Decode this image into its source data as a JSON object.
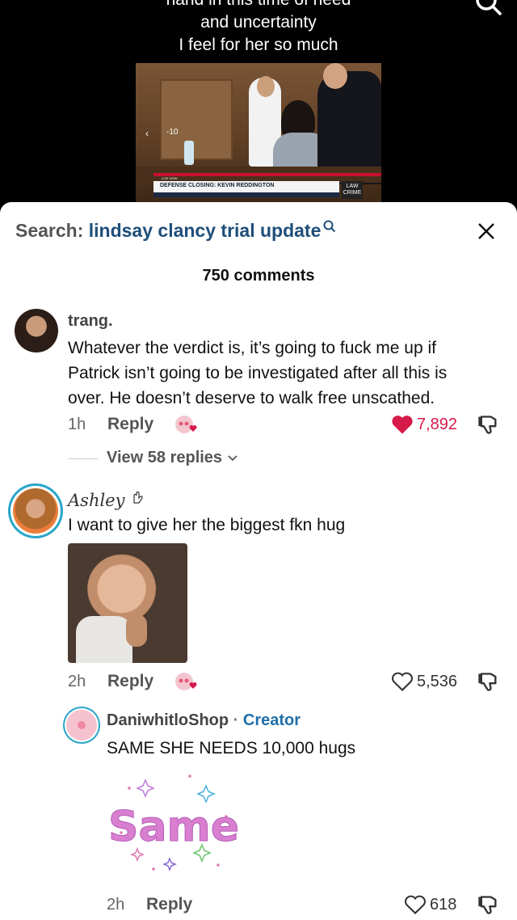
{
  "video": {
    "caption_lines": [
      "hand in this time of need",
      "and uncertainty",
      "I feel for her so much"
    ],
    "timer": "-10",
    "nav_back": "‹",
    "live_label": "LIVE NOW",
    "lower_third": "DEFENSE CLOSING: KEVIN REDDINGTON",
    "logo": "LAW CRIME"
  },
  "sheet": {
    "search_label": "Search:",
    "search_query": "lindsay clancy trial update",
    "comment_count": "750 comments"
  },
  "comments": [
    {
      "user": "trang.",
      "text_lines": [
        "Whatever the verdict is, it’s going to fuck me up if",
        "Patrick isn’t going to be investigated after all this is",
        "over. He doesn’t deserve to walk free unscathed."
      ],
      "time": "1h",
      "reply": "Reply",
      "likes": "7,892",
      "liked": true,
      "view_replies": "View 58 replies"
    },
    {
      "user": "Ashley",
      "text": "I want to give her the biggest fkn hug",
      "time": "2h",
      "reply": "Reply",
      "likes": "5,536"
    },
    {
      "user": "DaniwhitloShop",
      "separator": "·",
      "badge": "Creator",
      "text": "SAME SHE NEEDS 10,000 hugs",
      "sticker_text": "Same",
      "time": "2h",
      "reply": "Reply",
      "likes": "618"
    }
  ],
  "colors": {
    "accent_blue": "#1f4e79",
    "like_red": "#d61a4a",
    "creator_blue": "#1f6fa8"
  }
}
